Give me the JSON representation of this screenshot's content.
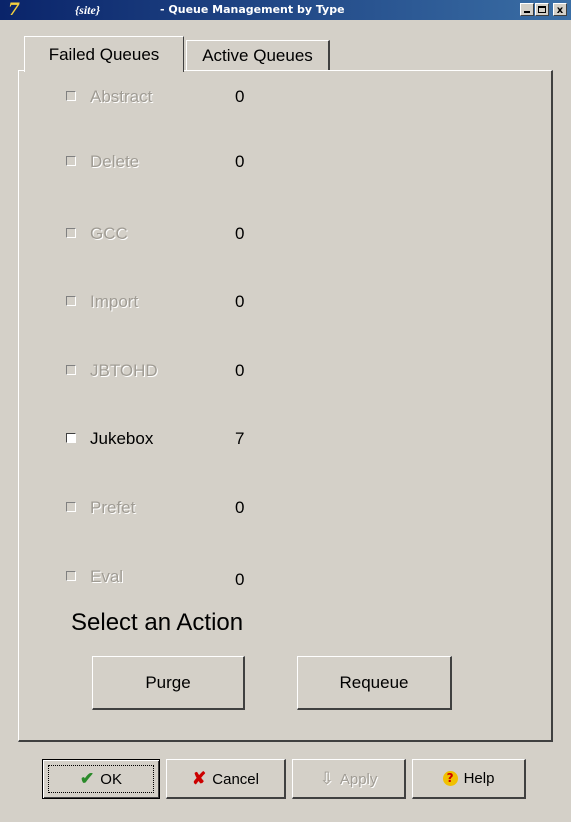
{
  "window": {
    "app_icon": "7",
    "title_site": "{site}",
    "title": "- Queue Management by Type",
    "controls": {
      "minimize": "",
      "maximize": "",
      "close": "x"
    }
  },
  "tabs": [
    {
      "label": "Failed Queues",
      "selected": true
    },
    {
      "label": "Active Queues",
      "selected": false
    }
  ],
  "queues": [
    {
      "label": "Abstract",
      "count": "0",
      "enabled": false
    },
    {
      "label": "Delete",
      "count": "0",
      "enabled": false
    },
    {
      "label": "GCC",
      "count": "0",
      "enabled": false
    },
    {
      "label": "Import",
      "count": "0",
      "enabled": false
    },
    {
      "label": "JBTOHD",
      "count": "0",
      "enabled": false
    },
    {
      "label": "Jukebox",
      "count": "7",
      "enabled": true
    },
    {
      "label": "Prefet",
      "count": "0",
      "enabled": false
    },
    {
      "label": "Eval",
      "count": "0",
      "enabled": false
    }
  ],
  "actions": {
    "heading": "Select an Action",
    "purge": "Purge",
    "requeue": "Requeue"
  },
  "footer": {
    "ok": "OK",
    "cancel": "Cancel",
    "apply": "Apply",
    "help": "Help",
    "ok_icon": "check-icon",
    "cancel_icon": "x-icon",
    "apply_icon": "down-arrow-icon",
    "help_icon": "question-icon"
  }
}
